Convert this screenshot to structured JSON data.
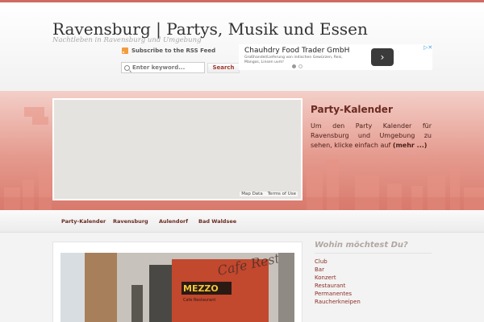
{
  "site": {
    "title": "Ravensburg | Partys, Musik und Essen",
    "tagline": "Nachtleben in Ravensburg und Umgebung"
  },
  "header": {
    "rss_label": "Subscribe to the RSS Feed",
    "search_placeholder": "Enter keyword...",
    "search_button": "Search"
  },
  "ad": {
    "title": "Chauhdry Food Trader GmbH",
    "text": "Großhandel/Lieferung von indischen Gewürzen, Reis, Mangos, Linsen uvm!",
    "button": "›",
    "adchoices": "▷✕"
  },
  "banner": {
    "party_title": "Party-Kalender",
    "party_text": "Um den Party Kalender für Ravensburg und Umgebung zu sehen, klicke einfach auf",
    "party_more": "(mehr ...)",
    "map_data": "Map Data",
    "map_terms": "Terms of Use"
  },
  "nav": {
    "items": [
      "Party-Kalender",
      "Ravensburg",
      "Aulendorf",
      "Bad Waldsee"
    ]
  },
  "photo": {
    "sign_name": "MEZZO",
    "sign_subtitle": "Cafe Restaurant",
    "sign_script": "Cafe Restaurant"
  },
  "sidebar": {
    "title": "Wohin möchtest Du?",
    "items": [
      "Club",
      "Bar",
      "Konzert",
      "Restaurant",
      "Permanentes",
      "Raucherkneipen"
    ]
  },
  "colors": {
    "accent": "#cf6b62",
    "banner": "#e59a8e",
    "link": "#8a2e25"
  }
}
